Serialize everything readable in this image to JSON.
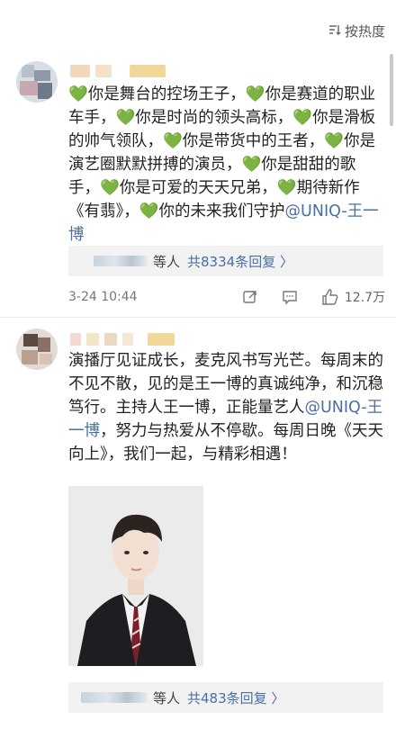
{
  "sort": {
    "label": "按热度"
  },
  "comments": [
    {
      "body_segments": [
        {
          "t": "💚",
          "k": "heart"
        },
        {
          "t": "你是舞台的控场王子，",
          "k": "text"
        },
        {
          "t": "💚",
          "k": "heart"
        },
        {
          "t": "你是赛道的职业车手，",
          "k": "text"
        },
        {
          "t": "💚",
          "k": "heart"
        },
        {
          "t": "你是时尚的领头高标，",
          "k": "text"
        },
        {
          "t": "💚",
          "k": "heart"
        },
        {
          "t": "你是滑板的帅气领队，",
          "k": "text"
        },
        {
          "t": "💚",
          "k": "heart"
        },
        {
          "t": "你是带货中的王者，",
          "k": "text"
        },
        {
          "t": "💚",
          "k": "heart"
        },
        {
          "t": "你是演艺圈默默拼搏的演员，",
          "k": "text"
        },
        {
          "t": "💚",
          "k": "heart"
        },
        {
          "t": "你是甜甜的歌手，",
          "k": "text"
        },
        {
          "t": "💚",
          "k": "heart"
        },
        {
          "t": "你是可爱的天天兄弟，",
          "k": "text"
        },
        {
          "t": "💚",
          "k": "heart"
        },
        {
          "t": "期待新作《有翡》，",
          "k": "text"
        },
        {
          "t": "💚",
          "k": "heart"
        },
        {
          "t": "你的未来我们守护",
          "k": "text"
        },
        {
          "t": "@UNIQ-王一博",
          "k": "mention"
        }
      ],
      "reply_suffix": "等人",
      "reply_total": "共8334条回复 〉",
      "time": "3-24 10:44",
      "likes": "12.7万"
    },
    {
      "body_segments": [
        {
          "t": "演播厅见证成长，麦克风书写光芒。每周末的不见不散，见的是王一博的真诚纯净，和沉稳笃行。主持人王一博，正能量艺人",
          "k": "text"
        },
        {
          "t": "@UNIQ-王一博",
          "k": "mention"
        },
        {
          "t": "，努力与热爱从不停歇。每周日晚《天天向上》，我们一起，与精彩相遇！",
          "k": "text"
        }
      ],
      "reply_suffix": "等人",
      "reply_total": "共483条回复 〉"
    }
  ]
}
